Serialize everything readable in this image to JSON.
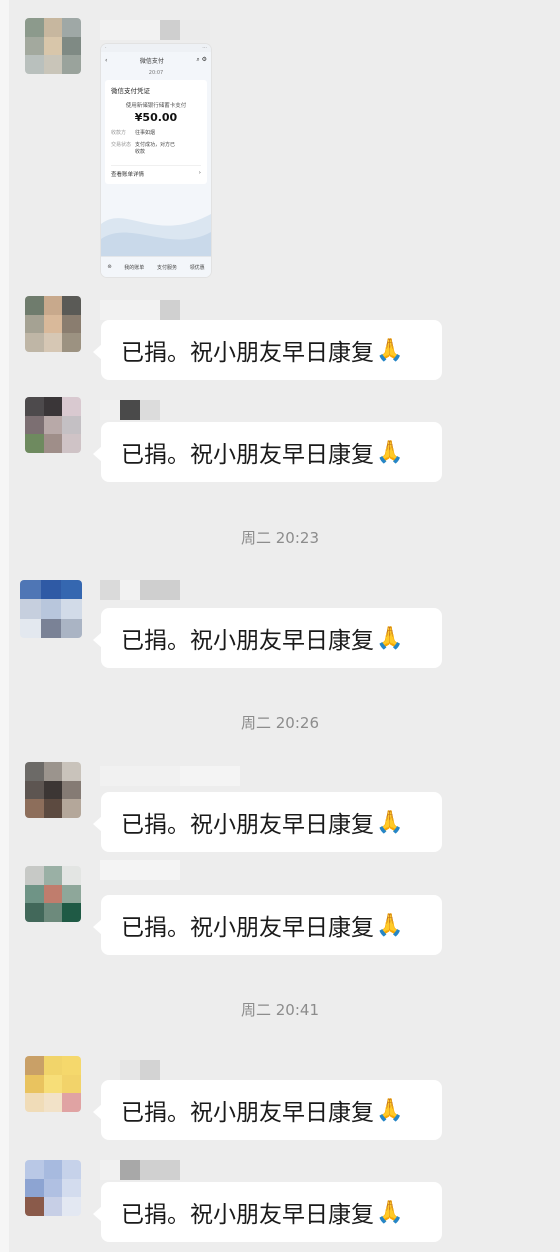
{
  "messages": [
    {
      "type": "image"
    },
    {
      "text": "已捐。祝小朋友早日康复",
      "emoji": "🙏"
    },
    {
      "text": "已捐。祝小朋友早日康复",
      "emoji": "🙏"
    },
    {
      "text": "已捐。祝小朋友早日康复",
      "emoji": "🙏"
    },
    {
      "text": "已捐。祝小朋友早日康复",
      "emoji": "🙏"
    },
    {
      "text": "已捐。祝小朋友早日康复",
      "emoji": "🙏"
    },
    {
      "text": "已捐。祝小朋友早日康复",
      "emoji": "🙏"
    },
    {
      "text": "已捐。祝小朋友早日康复",
      "emoji": "🙏"
    }
  ],
  "timestamps": [
    "周二 20:23",
    "周二 20:26",
    "周二 20:41"
  ],
  "receipt": {
    "nav_title": "微信支付",
    "time": "20:07",
    "card_title": "微信支付凭证",
    "desc": "使用新储银行储蓄卡支付",
    "amount": "¥50.00",
    "payee_label": "收款方",
    "payee_value": "往事如烟",
    "status_label": "交易状态",
    "status_value": "支付成功，对方已收款",
    "detail_link": "查看账单详情",
    "bottom_tabs": [
      "我的账单",
      "支付服务",
      "领优惠"
    ]
  },
  "colors": {
    "background": "#ededed",
    "bubble": "#ffffff",
    "timestamp": "#8c8c8c"
  }
}
